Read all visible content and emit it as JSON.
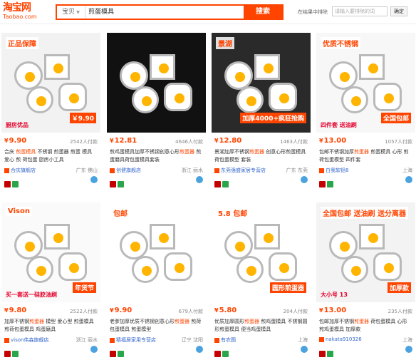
{
  "header": {
    "logo_main": "淘宝网",
    "logo_sub": "Taobao.com",
    "search_scope": "宝贝",
    "search_query": "煎蛋模具",
    "search_button": "搜索",
    "within_label": "在结果中排除",
    "within_placeholder": "请输入要排除的词",
    "within_button": "确定"
  },
  "colors": {
    "brand": "#ff4400",
    "link": "#3366cc"
  },
  "products": [
    {
      "price": "9.90",
      "paid": "2542人付款",
      "title_pre": "合庆 ",
      "title_hl": "煎蛋模具",
      "title_post": " 不锈钢 煎蛋器 煎蛋 模具 爱心 煎 荷包蛋 厨房小工具",
      "shop": "合庆旗舰店",
      "location": "广东 佛山",
      "img_label1": "正品保障",
      "img_label2": "￥9.90",
      "img_label3": "厨房优品"
    },
    {
      "price": "12.81",
      "paid": "4646人付款",
      "title_pre": "煎鸡蛋模具加厚不锈钢创意心形",
      "title_hl": "煎蛋器",
      "title_post": " 煎蛋磨具荷包蛋模具套装",
      "shop": "创健旗舰店",
      "location": "浙江 丽水",
      "img_label1": "",
      "img_label2": "",
      "img_label3": ""
    },
    {
      "price": "12.80",
      "paid": "1463人付款",
      "title_pre": "景湖加厚不锈钢",
      "title_hl": "煎蛋器",
      "title_post": " 创意心形煎蛋模具 荷包蛋模型 套装",
      "shop": "东莞强盛家居专营店",
      "location": "广东 东莞",
      "img_label1": "景湖",
      "img_label2": "加厚4000+疯狂抢购",
      "img_label3": ""
    },
    {
      "price": "13.00",
      "paid": "1057人付款",
      "title_pre": "包邮不锈钢加厚",
      "title_hl": "煎蛋器",
      "title_post": " 煎蛋模具 心形 煎荷包蛋模型 四件套",
      "shop": "白我软铝8",
      "location": "上海",
      "img_label1": "优质不锈钢",
      "img_label2": "全国包邮",
      "img_label3": "四件套 送油刷"
    },
    {
      "price": "9.80",
      "paid": "2522人付款",
      "title_pre": "加厚不锈钢",
      "title_hl": "煎蛋器",
      "title_post": " 模型 爱心型 煎蛋模具 煎荷包蛋模具 鸡蛋磨具",
      "shop": "vison伟森旗舰店",
      "location": "浙江 丽水",
      "img_label1": "Vison",
      "img_label2": "年货节",
      "img_label3": "买一套送一硅胶油刷"
    },
    {
      "price": "9.90",
      "paid": "679人付款",
      "title_pre": "老爹加厚优质不锈钢创意心形",
      "title_hl": "煎蛋器",
      "title_post": " 煎荷包蛋模具 煎蛋模型",
      "shop": "精福居家用专营店",
      "location": "辽宁 沈阳",
      "img_label1": "包邮",
      "img_label2": "",
      "img_label3": ""
    },
    {
      "price": "5.80",
      "paid": "204人付款",
      "title_pre": "优质加厚圆形",
      "title_hl": "煎蛋器",
      "title_post": " 煎鸡蛋模具 不锈钢圆形煎蛋模具 便当鸡蛋模具",
      "shop": "有农圆",
      "location": "上海",
      "img_label1": "5.8 包邮",
      "img_label2": "圆形煎蛋器",
      "img_label3": ""
    },
    {
      "price": "13.00",
      "paid": "235人付款",
      "title_pre": "包邮加厚不锈钢",
      "title_hl": "煎蛋器",
      "title_post": " 荷包蛋模具 心形 煎鸡蛋模具 加厚款",
      "shop": "nakata910326",
      "location": "上海",
      "img_label1": "全国包邮 送油刷 送分离器",
      "img_label2": "加厚款",
      "img_label3": "大小号 13"
    }
  ]
}
